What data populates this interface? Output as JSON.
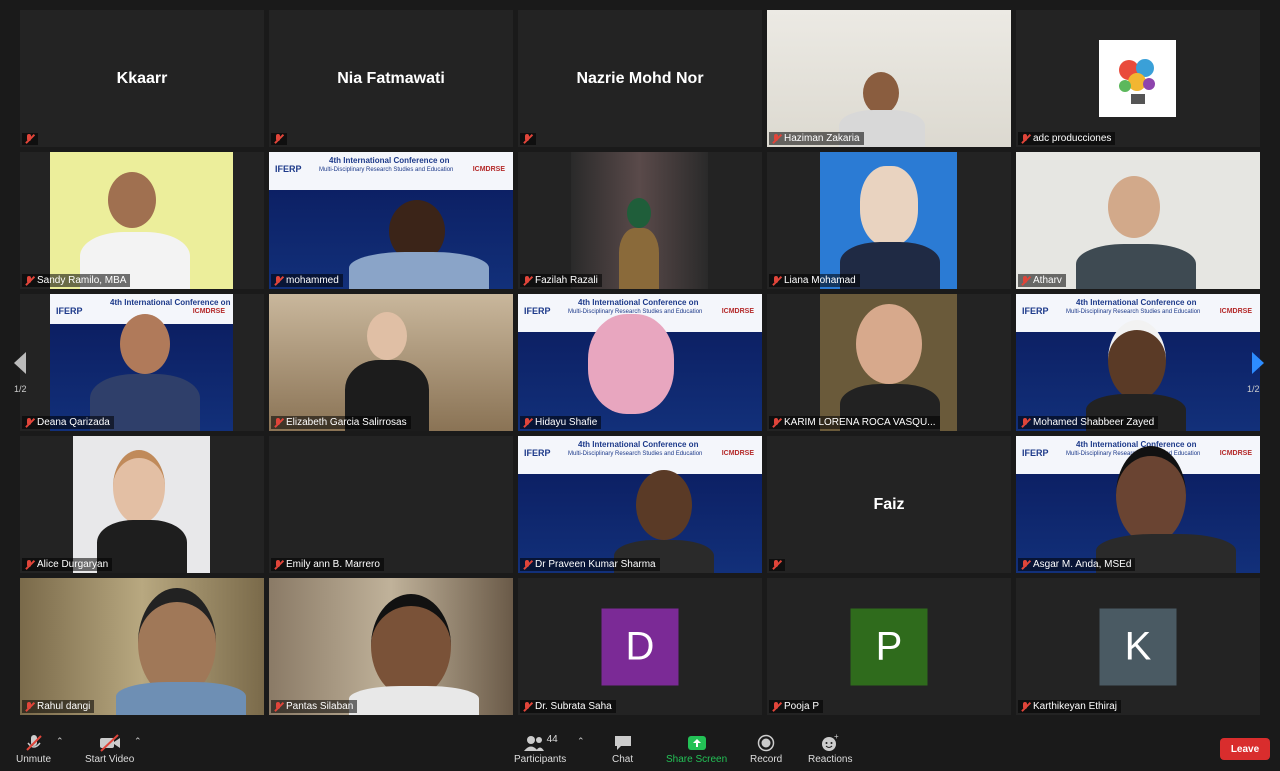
{
  "participants": [
    {
      "name": "Kkaarr",
      "label": "",
      "kind": "name"
    },
    {
      "name": "Nia Fatmawati",
      "label": "",
      "kind": "name"
    },
    {
      "name": "Nazrie Mohd Nor",
      "label": "",
      "kind": "name"
    },
    {
      "label": "Haziman Zakaria",
      "kind": "video"
    },
    {
      "label": "adc producciones",
      "kind": "logo"
    },
    {
      "label": "Sandy Ramilo, MBA",
      "kind": "video"
    },
    {
      "label": "mohammed",
      "kind": "video"
    },
    {
      "label": "Fazilah Razali",
      "kind": "video"
    },
    {
      "label": "Liana Mohamad",
      "kind": "video"
    },
    {
      "label": "Atharv",
      "kind": "video"
    },
    {
      "label": "Deana Qarizada",
      "kind": "video"
    },
    {
      "label": "Elizabeth Garcia Salirrosas",
      "kind": "video"
    },
    {
      "label": "Hidayu Shafie",
      "kind": "video"
    },
    {
      "label": "KARIM LORENA ROCA VASQU...",
      "kind": "video"
    },
    {
      "label": "Mohamed Shabbeer Zayed",
      "kind": "video"
    },
    {
      "label": "Alice Durgaryan",
      "kind": "video"
    },
    {
      "label": "Emily ann B. Marrero",
      "kind": "empty"
    },
    {
      "label": "Dr Praveen Kumar Sharma",
      "kind": "video"
    },
    {
      "name": "Faiz",
      "label": "",
      "kind": "name"
    },
    {
      "label": "Asgar M. Anda, MSEd",
      "kind": "video"
    },
    {
      "label": "Rahul dangi",
      "kind": "video"
    },
    {
      "label": "Pantas Silaban",
      "kind": "video"
    },
    {
      "label": "Dr. Subrata Saha",
      "kind": "avatar",
      "initial": "D",
      "color": "#7b2a96"
    },
    {
      "label": "Pooja P",
      "kind": "avatar",
      "initial": "P",
      "color": "#2f6b1c"
    },
    {
      "label": "Karthikeyan Ethiraj",
      "kind": "avatar",
      "initial": "K",
      "color": "#4a5a63"
    }
  ],
  "banner": {
    "logo": "IFERP",
    "title": "4th International Conference on",
    "subtitle": "Multi-Disciplinary Research Studies and Education",
    "logo2": "ICMDRSE"
  },
  "pagination": {
    "left": "1/2",
    "right": "1/2"
  },
  "toolbar": {
    "unmute": "Unmute",
    "start_video": "Start Video",
    "participants": "Participants",
    "participant_count": "44",
    "chat": "Chat",
    "share_screen": "Share Screen",
    "record": "Record",
    "reactions": "Reactions",
    "leave": "Leave"
  },
  "colors": {
    "share_green": "#23c156",
    "leave_red": "#d92d2d",
    "mute_red": "#e0453a"
  }
}
